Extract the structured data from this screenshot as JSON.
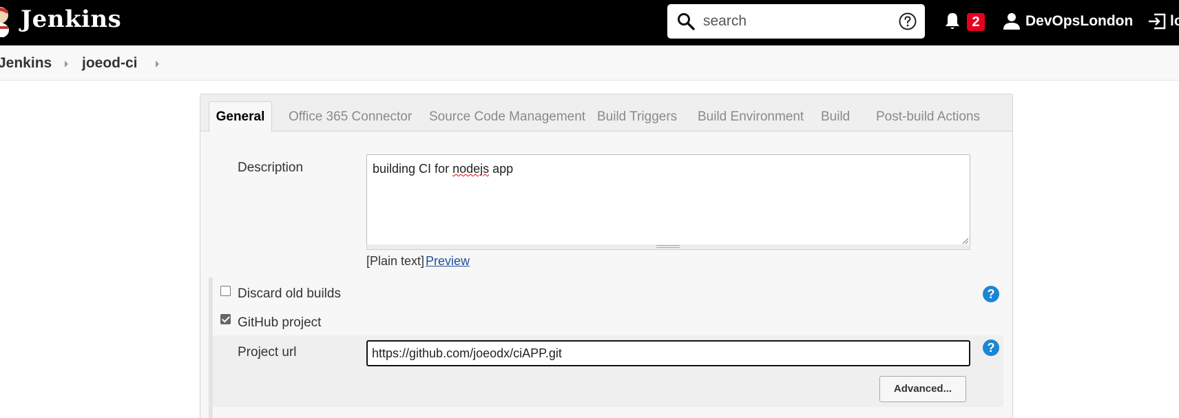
{
  "header": {
    "brand": "Jenkins",
    "search": {
      "placeholder": "search"
    },
    "notifications_count": "2",
    "user_name": "DevOpsLondon",
    "logout_label": "lo"
  },
  "breadcrumb": {
    "items": [
      {
        "label": "Jenkins"
      },
      {
        "label": "joeod-ci"
      }
    ]
  },
  "tabs": [
    {
      "label": "General",
      "active": true
    },
    {
      "label": "Office 365 Connector"
    },
    {
      "label": "Source Code Management"
    },
    {
      "label": "Build Triggers"
    },
    {
      "label": "Build Environment"
    },
    {
      "label": "Build"
    },
    {
      "label": "Post-build Actions"
    }
  ],
  "general": {
    "description_label": "Description",
    "description_value_before": "building CI for ",
    "description_value_spell": "nodejs",
    "description_value_after": " app",
    "markup_format": "[Plain text]",
    "preview_label": "Preview",
    "discard_old_builds": {
      "label": "Discard old builds",
      "checked": false
    },
    "github_project": {
      "label": "GitHub project",
      "checked": true
    },
    "project_url": {
      "label": "Project url",
      "value": "https://github.com/joeodx/ciAPP.git"
    },
    "advanced_label": "Advanced...",
    "help_symbol": "?"
  },
  "colors": {
    "header_bg": "#000000",
    "badge": "#e6001f",
    "help_icon": "#1b87d4",
    "link": "#1f4e9c"
  }
}
